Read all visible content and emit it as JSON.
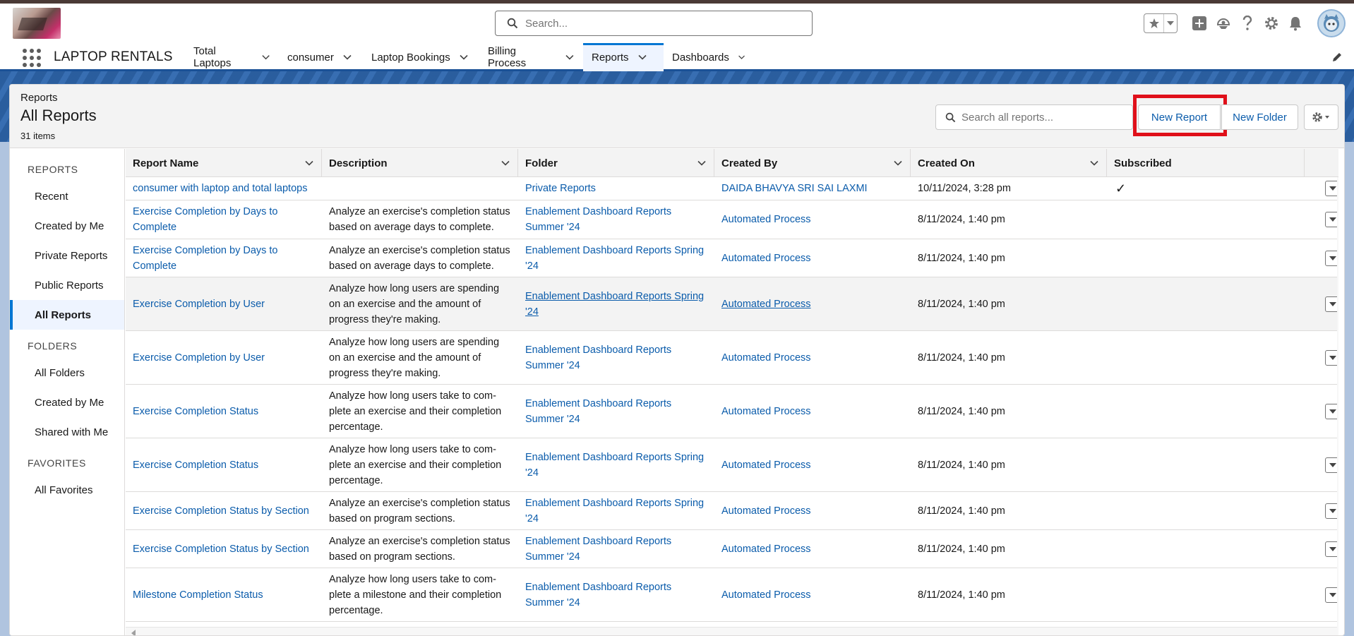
{
  "header": {
    "search_placeholder": "Search...",
    "app_name": "LAPTOP RENTALS"
  },
  "nav": {
    "tabs": [
      {
        "label": "Total Laptops"
      },
      {
        "label": "consumer"
      },
      {
        "label": "Laptop Bookings"
      },
      {
        "label": "Billing Process"
      },
      {
        "label": "Reports",
        "active": true
      },
      {
        "label": "Dashboards"
      }
    ]
  },
  "page": {
    "breadcrumb": "Reports",
    "title": "All Reports",
    "count": "31 items",
    "search_placeholder": "Search all reports...",
    "new_report": "New Report",
    "new_folder": "New Folder"
  },
  "sidebar": {
    "reports_heading": "REPORTS",
    "reports": [
      "Recent",
      "Created by Me",
      "Private Reports",
      "Public Reports",
      "All Reports"
    ],
    "folders_heading": "FOLDERS",
    "folders": [
      "All Folders",
      "Created by Me",
      "Shared with Me"
    ],
    "favorites_heading": "FAVORITES",
    "favorites": [
      "All Favorites"
    ]
  },
  "table": {
    "columns": [
      "Report Name",
      "Description",
      "Folder",
      "Created By",
      "Created On",
      "Subscribed"
    ],
    "rows": [
      {
        "name": "consumer with laptop and total laptops",
        "description": "",
        "folder": "Private Reports",
        "created_by": "DAIDA BHAVYA SRI SAI LAXMI",
        "created_on": "10/11/2024, 3:28 pm",
        "subscribed": "✓"
      },
      {
        "name": "Exercise Completion by Days to Complete",
        "description": "Analyze an exercise's completion status based on average days to complete.",
        "folder": "Enablement Dashboard Reports Summer '24",
        "created_by": "Automated Process",
        "created_on": "8/11/2024, 1:40 pm",
        "subscribed": ""
      },
      {
        "name": "Exercise Completion by Days to Complete",
        "description": "Analyze an exercise's completion status based on average days to complete.",
        "folder": "Enablement Dashboard Reports Spring '24",
        "created_by": "Automated Process",
        "created_on": "8/11/2024, 1:40 pm",
        "subscribed": ""
      },
      {
        "name": "Exercise Completion by User",
        "description": "Analyze how long users are spending on an exercise and the amount of progress they're making.",
        "folder": "Enablement Dashboard Reports Spring '24",
        "created_by": "Automated Process",
        "created_on": "8/11/2024, 1:40 pm",
        "subscribed": ""
      },
      {
        "name": "Exercise Completion by User",
        "description": "Analyze how long users are spending on an exercise and the amount of progress they're making.",
        "folder": "Enablement Dashboard Reports Summer '24",
        "created_by": "Automated Process",
        "created_on": "8/11/2024, 1:40 pm",
        "subscribed": ""
      },
      {
        "name": "Exercise Completion Status",
        "description": "Analyze how long users take to com-plete an exercise and their completion percentage.",
        "folder": "Enablement Dashboard Reports Summer '24",
        "created_by": "Automated Process",
        "created_on": "8/11/2024, 1:40 pm",
        "subscribed": ""
      },
      {
        "name": "Exercise Completion Status",
        "description": "Analyze how long users take to com-plete an exercise and their completion percentage.",
        "folder": "Enablement Dashboard Reports Spring '24",
        "created_by": "Automated Process",
        "created_on": "8/11/2024, 1:40 pm",
        "subscribed": ""
      },
      {
        "name": "Exercise Completion Status by Section",
        "description": "Analyze an exercise's completion status based on program sections.",
        "folder": "Enablement Dashboard Reports Spring '24",
        "created_by": "Automated Process",
        "created_on": "8/11/2024, 1:40 pm",
        "subscribed": ""
      },
      {
        "name": "Exercise Completion Status by Section",
        "description": "Analyze an exercise's completion status based on program sections.",
        "folder": "Enablement Dashboard Reports Summer '24",
        "created_by": "Automated Process",
        "created_on": "8/11/2024, 1:40 pm",
        "subscribed": ""
      },
      {
        "name": "Milestone Completion Status",
        "description": "Analyze how long users take to com-plete a milestone and their completion percentage.",
        "folder": "Enablement Dashboard Reports Summer '24",
        "created_by": "Automated Process",
        "created_on": "8/11/2024, 1:40 pm",
        "subscribed": ""
      }
    ]
  }
}
